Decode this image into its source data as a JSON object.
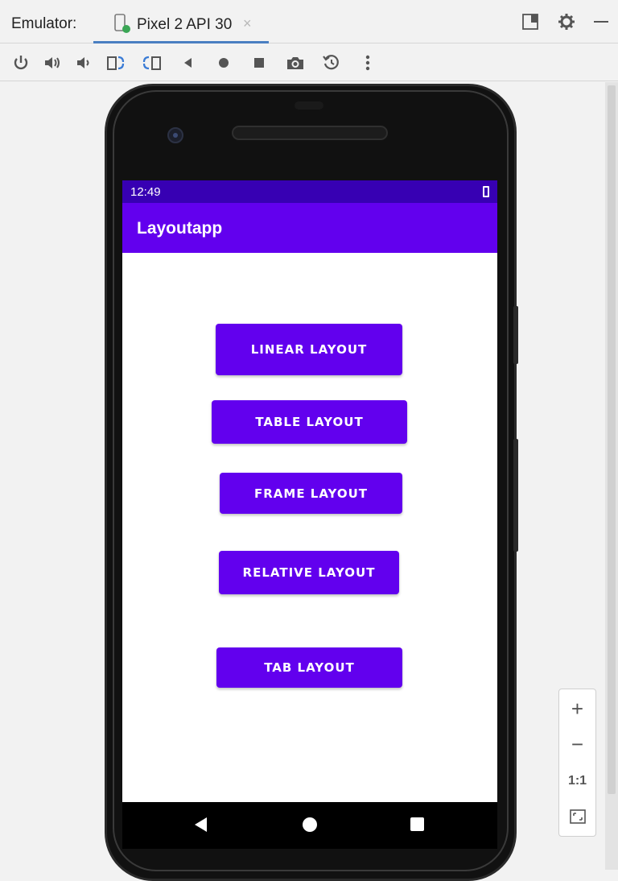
{
  "window": {
    "emulator_label": "Emulator:",
    "tab_label": "Pixel 2 API 30",
    "tab_close": "×",
    "accent": "#4a7fc1"
  },
  "toolbar": {
    "icons": [
      "power-icon",
      "volume-up-icon",
      "volume-down-icon",
      "rotate-left-icon",
      "rotate-right-icon",
      "back-icon",
      "home-icon",
      "overview-icon",
      "screenshot-icon",
      "snapshot-icon",
      "more-icon"
    ]
  },
  "device": {
    "status_time": "12:49",
    "app_title": "Layoutapp",
    "status_bar_color": "#3700b3",
    "app_bar_color": "#6200ee",
    "buttons": [
      {
        "label": "LINEAR LAYOUT"
      },
      {
        "label": "TABLE LAYOUT"
      },
      {
        "label": "FRAME LAYOUT"
      },
      {
        "label": "RELATIVE LAYOUT"
      },
      {
        "label": "TAB LAYOUT"
      }
    ]
  },
  "zoom": {
    "zoom_in": "+",
    "zoom_out": "−",
    "actual_size": "1:1"
  }
}
